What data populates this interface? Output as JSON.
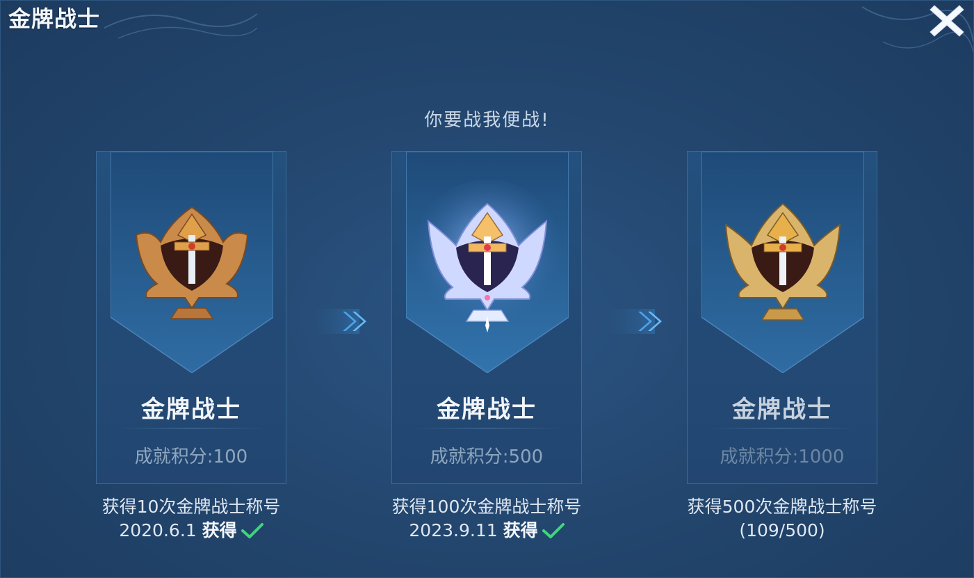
{
  "header": {
    "title": "金牌战士",
    "close_icon": "close-icon"
  },
  "slogan": "你要战我便战!",
  "tiers": [
    {
      "name": "金牌战士",
      "score": "成就积分:100",
      "badge": "bronze-warrior-badge-icon",
      "requirement": "获得10次金牌战士称号",
      "date": "2020.6.1",
      "status_label": "获得",
      "status_icon": "check-icon",
      "achieved": true
    },
    {
      "name": "金牌战士",
      "score": "成就积分:500",
      "badge": "silver-warrior-badge-icon",
      "requirement": "获得100次金牌战士称号",
      "date": "2023.9.11",
      "status_label": "获得",
      "status_icon": "check-icon",
      "achieved": true
    },
    {
      "name": "金牌战士",
      "score": "成就积分:1000",
      "badge": "gold-warrior-badge-icon",
      "requirement": "获得500次金牌战士称号",
      "progress": "(109/500)",
      "achieved": false
    }
  ],
  "colors": {
    "background": "#23476f",
    "card": "#234a75",
    "check": "#3fd67a",
    "bronze": "#c98a4a",
    "silver": "#cfd8ff",
    "gold": "#d9b46a"
  }
}
